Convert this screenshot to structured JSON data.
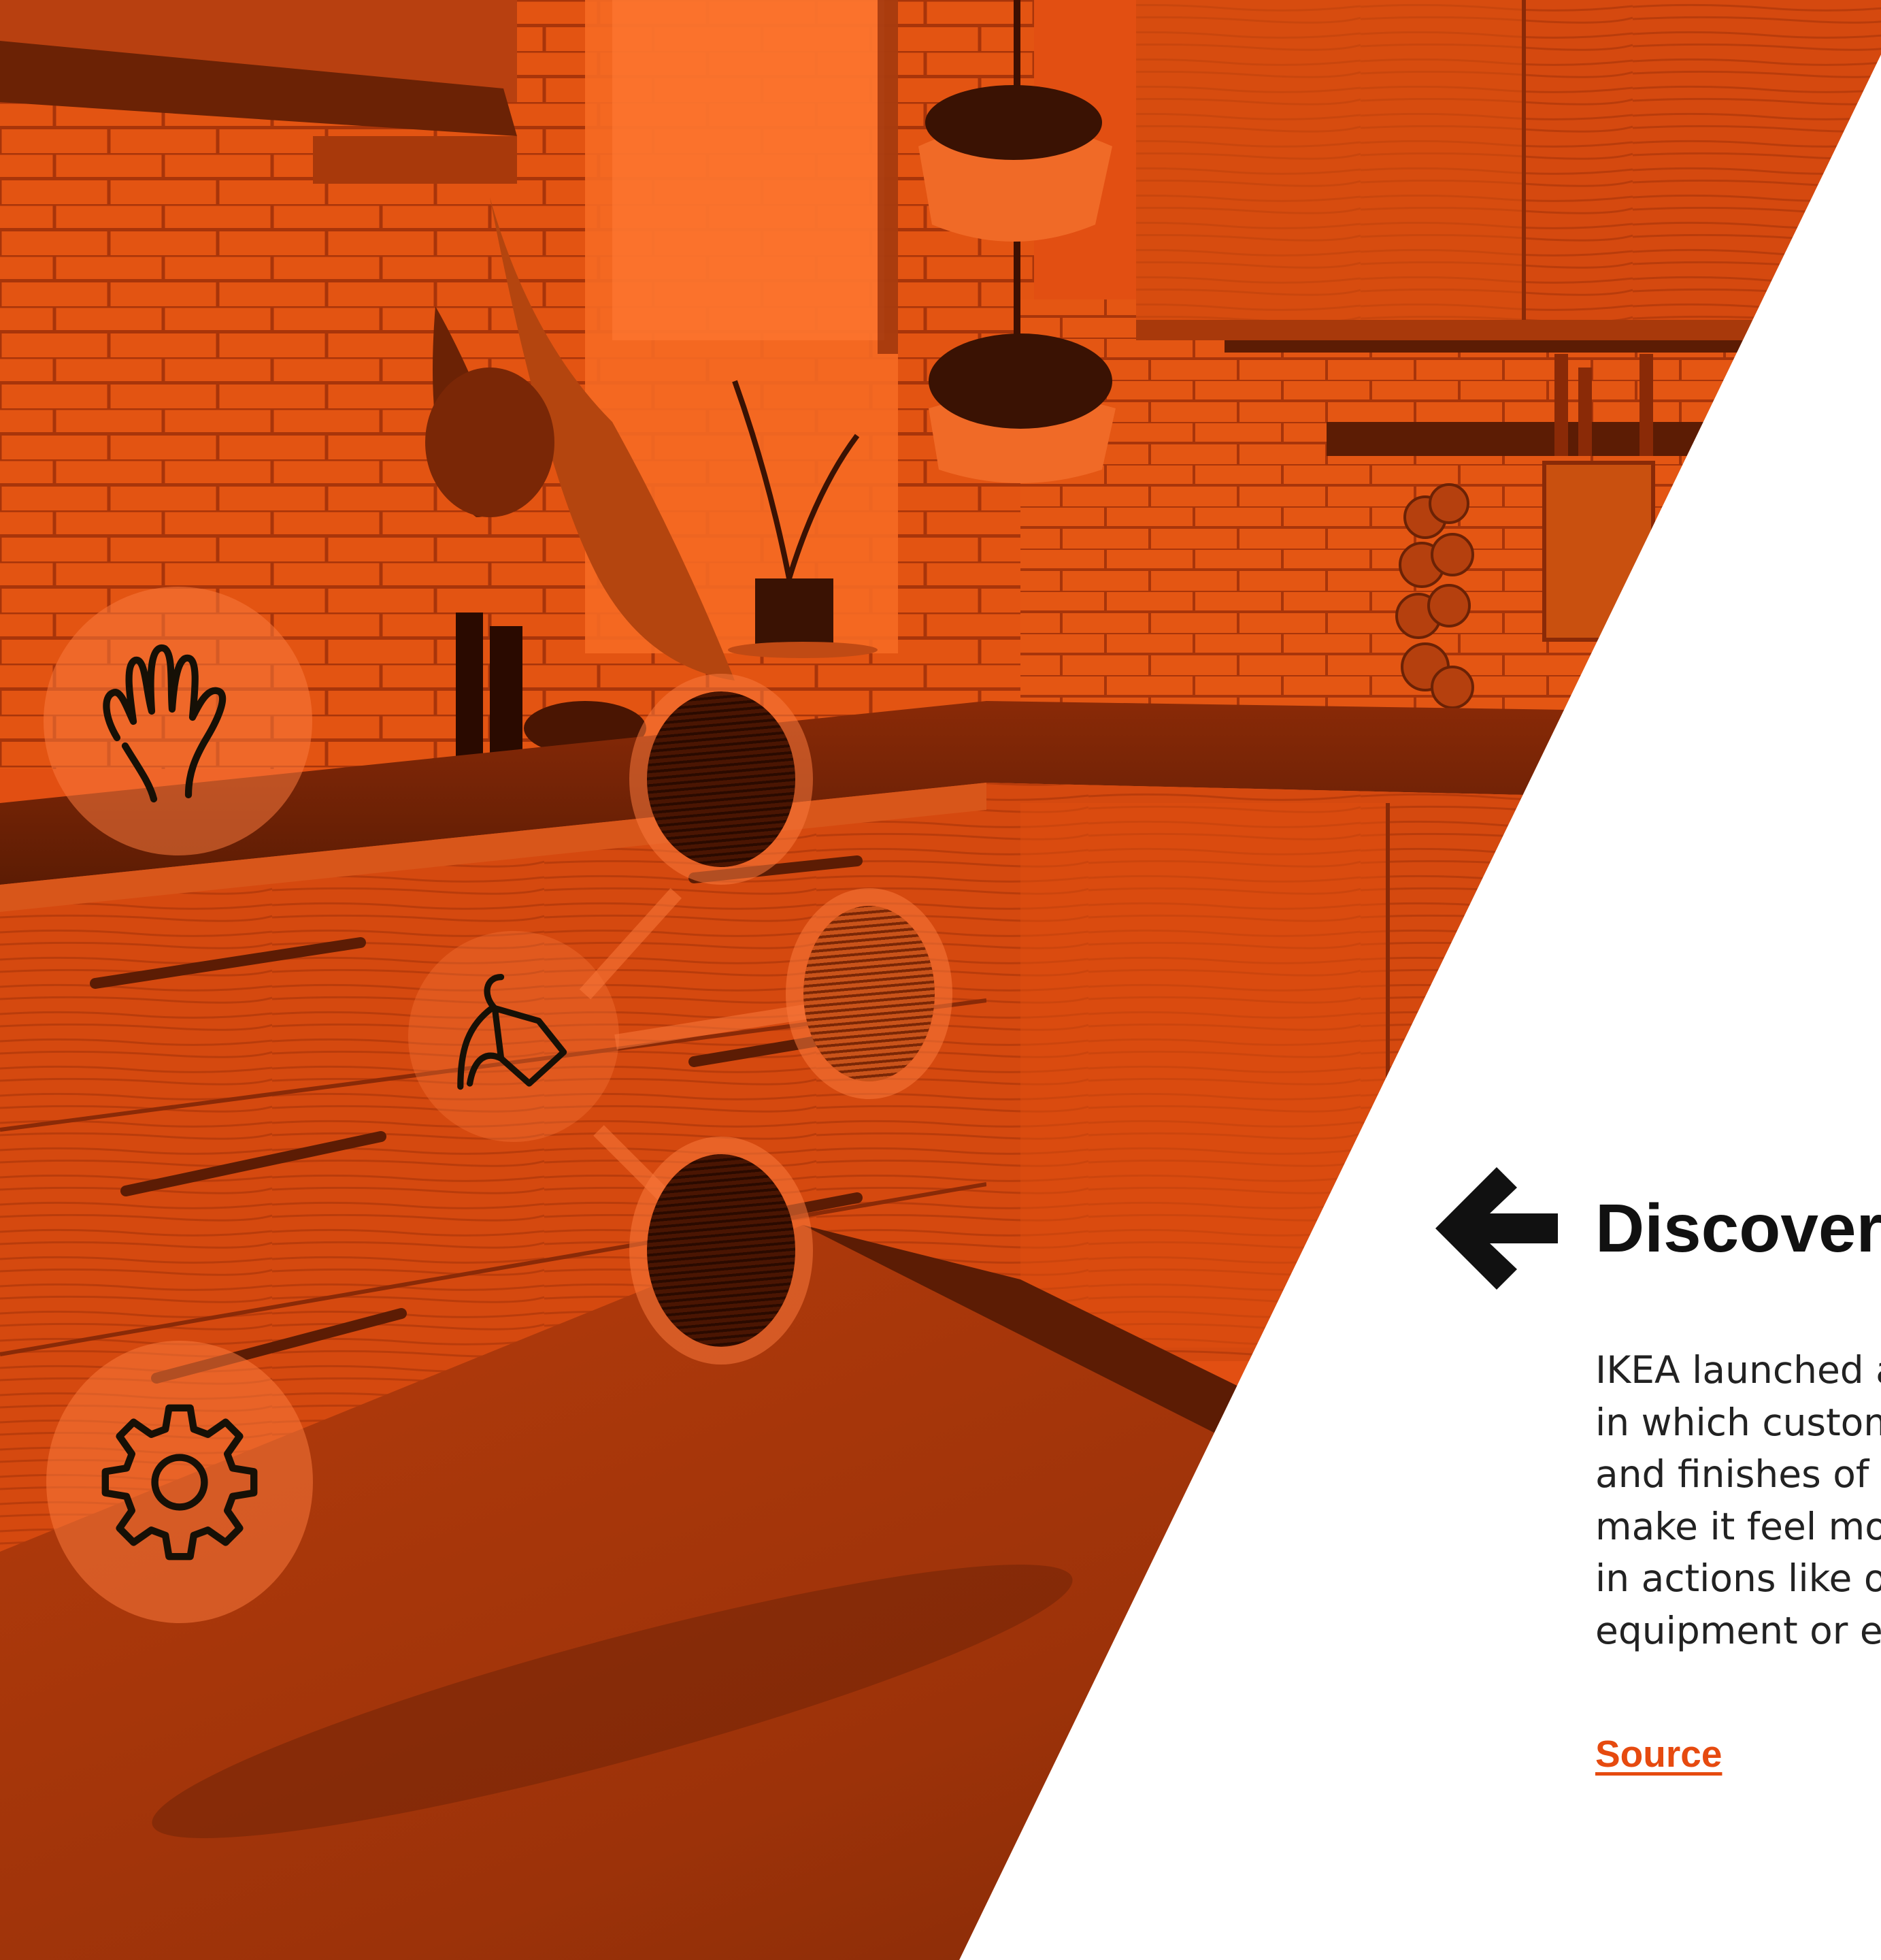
{
  "panel": {
    "heading": "Discover",
    "body_lines": [
      "IKEA launched a",
      "in which custom",
      "and finishes of t",
      "make it feel mo",
      "in actions like o",
      "equipment or ev"
    ],
    "source_link": "Source"
  },
  "icons": {
    "back": "arrow-left-icon",
    "hand": "hand-icon",
    "paint": "paint-bucket-icon",
    "settings": "gear-icon"
  },
  "colors": {
    "photo_tint": "#e24f12",
    "accent": "#e64a0f",
    "text": "#111111",
    "background": "#ffffff"
  }
}
